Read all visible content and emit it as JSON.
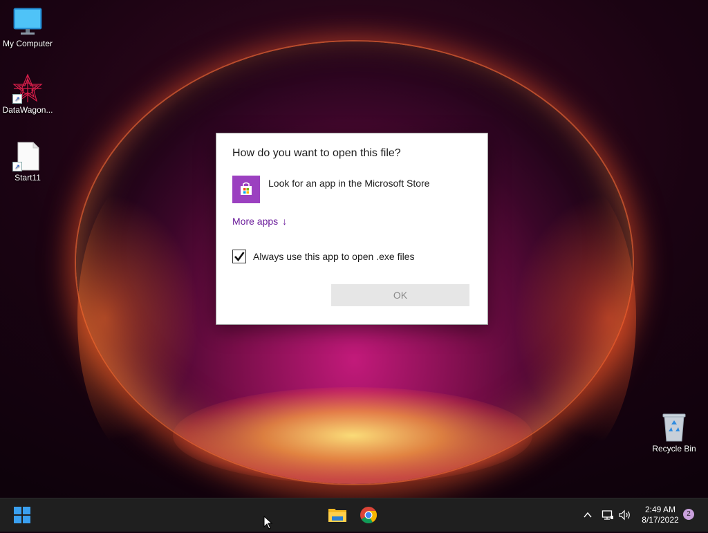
{
  "desktop": {
    "icons": [
      {
        "label": "My Computer",
        "icon": "monitor-icon"
      },
      {
        "label": "DataWagon...",
        "icon": "datawagon-icon"
      },
      {
        "label": "Start11",
        "icon": "document-icon"
      },
      {
        "label": "Recycle Bin",
        "icon": "recycle-bin-icon"
      }
    ]
  },
  "dialog": {
    "title": "How do you want to open this file?",
    "store_option": "Look for an app in the Microsoft Store",
    "more_apps": "More apps",
    "more_apps_arrow": "↓",
    "always_use_label": "Always use this app to open .exe files",
    "always_use_checked": true,
    "ok_label": "OK"
  },
  "taskbar": {
    "pinned": [
      "start-icon",
      "file-explorer-icon",
      "chrome-icon"
    ],
    "tray": {
      "chevron": "^",
      "time": "2:49 AM",
      "date": "8/17/2022",
      "notification_count": "2"
    }
  },
  "colors": {
    "accent_purple": "#6a1b9a",
    "store_icon_bg": "#9b40c0",
    "taskbar_bg": "#1f1f1f",
    "start_blue": "#3aa0f0"
  }
}
